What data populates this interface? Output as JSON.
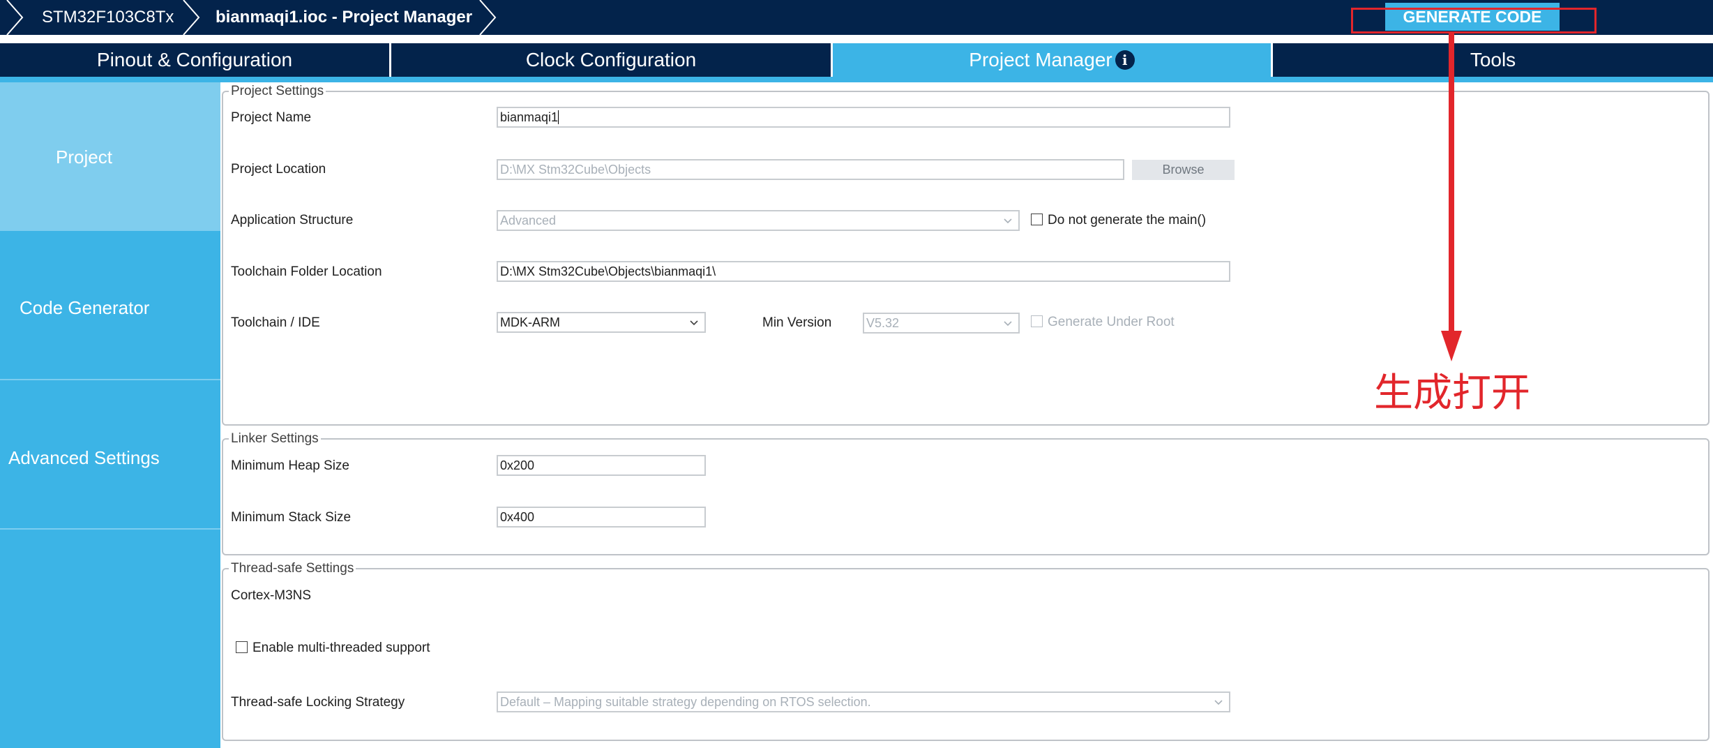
{
  "breadcrumb": {
    "device": "STM32F103C8Tx",
    "project": "bianmaqi1.ioc - Project Manager"
  },
  "toolbar": {
    "generate_label": "GENERATE CODE"
  },
  "tabs": [
    {
      "label": "Pinout & Configuration"
    },
    {
      "label": "Clock Configuration"
    },
    {
      "label": "Project Manager",
      "info": "i"
    },
    {
      "label": "Tools"
    }
  ],
  "sidebar": {
    "items": [
      {
        "label": "Project"
      },
      {
        "label": "Code Generator"
      },
      {
        "label": "Advanced Settings"
      }
    ]
  },
  "project_settings": {
    "legend": "Project Settings",
    "project_name_label": "Project Name",
    "project_name_value": "bianmaqi1",
    "project_location_label": "Project Location",
    "project_location_value": "D:\\MX Stm32Cube\\Objects",
    "browse_label": "Browse",
    "app_structure_label": "Application Structure",
    "app_structure_value": "Advanced",
    "no_main_label": "Do not generate the main()",
    "toolchain_folder_label": "Toolchain Folder Location",
    "toolchain_folder_value": "D:\\MX Stm32Cube\\Objects\\bianmaqi1\\",
    "toolchain_ide_label": "Toolchain / IDE",
    "toolchain_ide_value": "MDK-ARM",
    "min_version_label": "Min Version",
    "min_version_value": "V5.32",
    "generate_under_root_label": "Generate Under Root"
  },
  "linker_settings": {
    "legend": "Linker Settings",
    "heap_label": "Minimum Heap Size",
    "heap_value": "0x200",
    "stack_label": "Minimum Stack Size",
    "stack_value": "0x400"
  },
  "thread_safe": {
    "legend": "Thread-safe Settings",
    "core": "Cortex-M3NS",
    "multithread_label": "Enable multi-threaded support",
    "strategy_label": "Thread-safe Locking Strategy",
    "strategy_value": "Default – Mapping suitable strategy depending on RTOS selection."
  },
  "annotation": {
    "text": "生成打开",
    "color": "#e2262b"
  },
  "colors": {
    "navy": "#03234b",
    "accent": "#3cb4e6",
    "sidebar_active": "#7fcdee"
  }
}
